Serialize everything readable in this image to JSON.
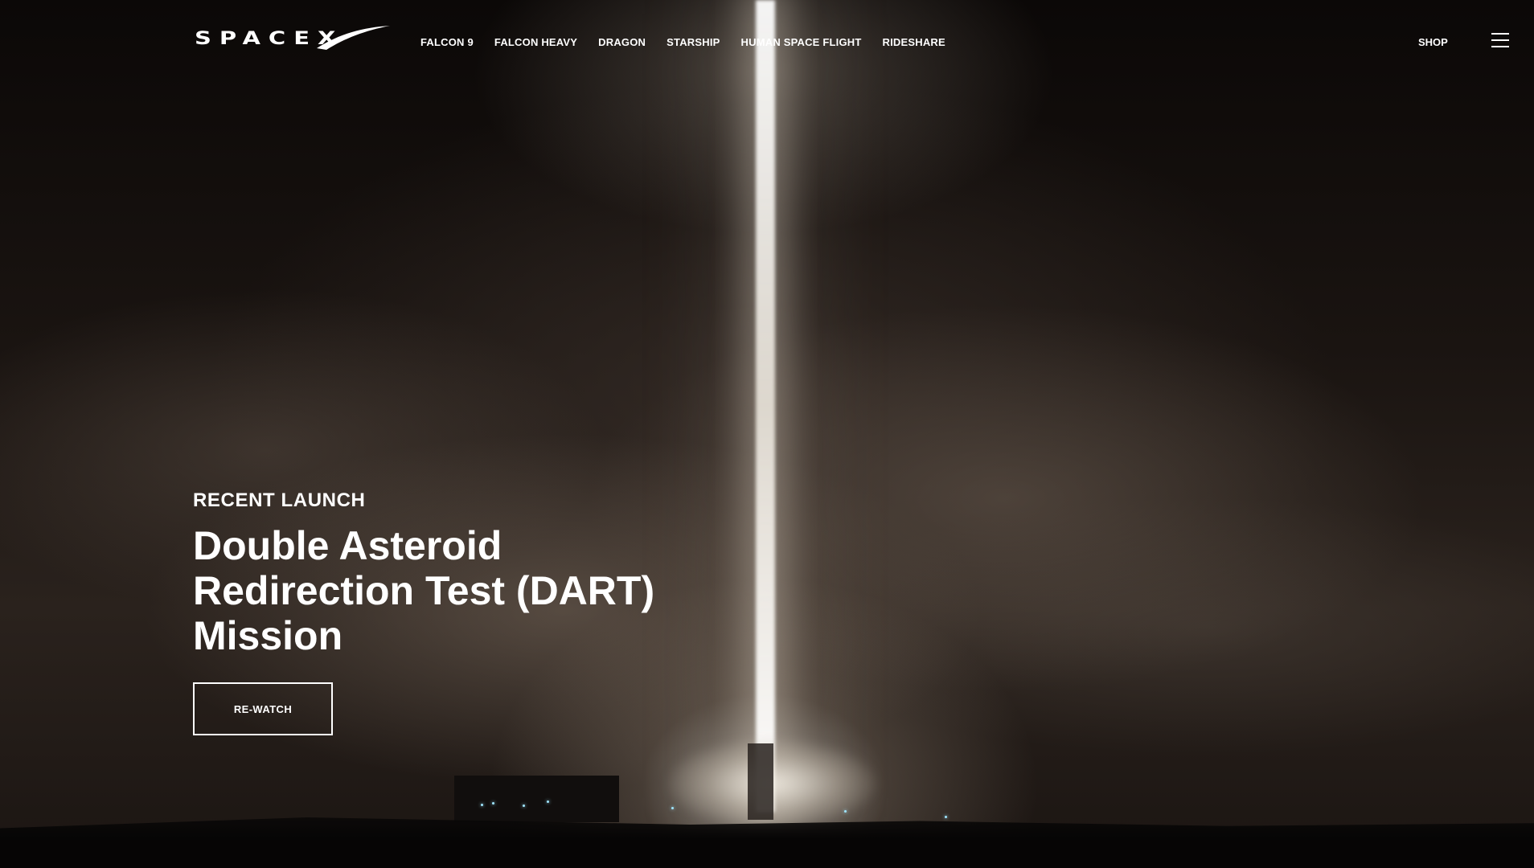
{
  "brand": {
    "logo_text": "SPACEX"
  },
  "nav": {
    "items": [
      {
        "label": "FALCON 9"
      },
      {
        "label": "FALCON HEAVY"
      },
      {
        "label": "DRAGON"
      },
      {
        "label": "STARSHIP"
      },
      {
        "label": "HUMAN SPACE FLIGHT"
      },
      {
        "label": "RIDESHARE"
      }
    ],
    "shop_label": "SHOP",
    "menu_icon": "hamburger-menu-icon"
  },
  "hero": {
    "eyebrow": "RECENT LAUNCH",
    "headline": "Double Asteroid Redirection Test (DART) Mission",
    "cta_label": "RE-WATCH",
    "background_description": "rocket-launch-night-photo"
  },
  "colors": {
    "text": "#ffffff",
    "background": "#0a0706",
    "accent": "#ffffff"
  }
}
